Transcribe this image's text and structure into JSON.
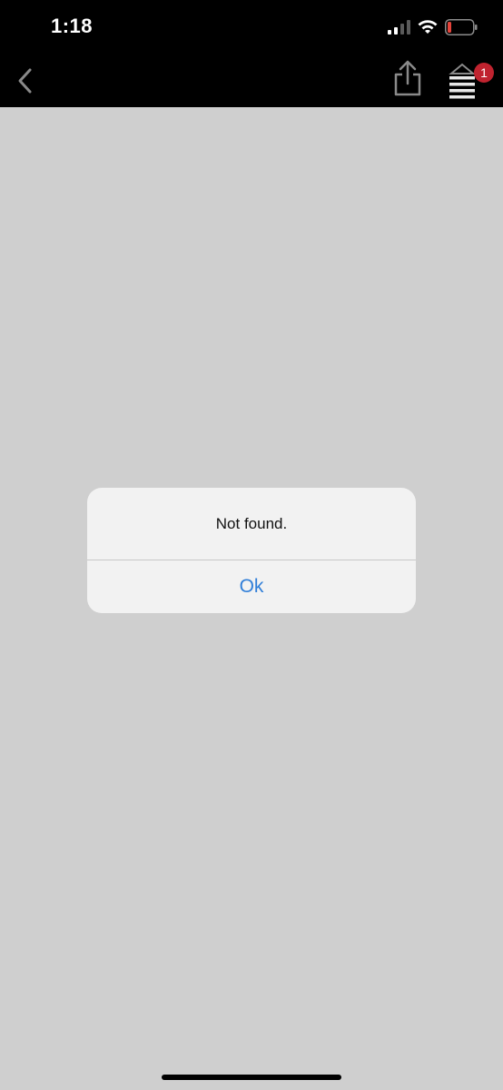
{
  "status_bar": {
    "time": "1:18",
    "signal_icon": "cellular-signal-icon",
    "wifi_icon": "wifi-icon",
    "battery_icon": "battery-low-icon",
    "battery_level": 0.15,
    "battery_color": "#e5443b"
  },
  "nav_bar": {
    "back_icon": "chevron-left-icon",
    "share_icon": "share-icon",
    "menu_icon": "stack-menu-icon",
    "badge_count": "1",
    "badge_color": "#c0232f",
    "icon_color": "#8a8a8a"
  },
  "alert": {
    "message": "Not found.",
    "ok_label": "Ok",
    "button_color": "#2f7ed8"
  }
}
